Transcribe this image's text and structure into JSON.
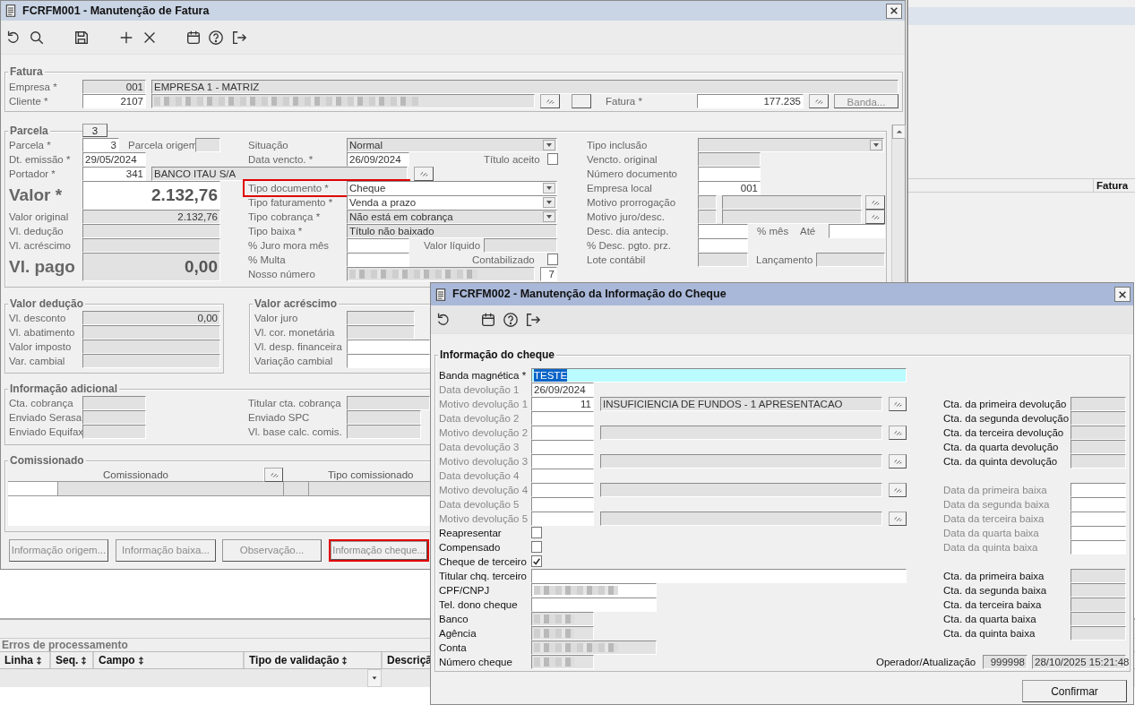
{
  "main_window": {
    "title": "FCRFM001 - Manutenção de Fatura",
    "fatura": {
      "legend": "Fatura",
      "rows": [
        [
          {
            "kind": "label",
            "text": "Empresa *"
          },
          {
            "kind": "number",
            "value": "001",
            "readonly": true
          },
          {
            "kind": "text",
            "value": "EMPRESA 1 - MATRIZ",
            "readonly": true
          }
        ],
        [
          {
            "kind": "label",
            "text": "Cliente *"
          },
          {
            "kind": "number",
            "value": "2107",
            "readonly": false
          },
          {
            "kind": "redacted",
            "readonly": true
          },
          {
            "kind": "lookup"
          },
          {
            "kind": "plain_button"
          },
          {
            "kind": "label",
            "text": "Fatura *"
          },
          {
            "kind": "number",
            "value": "177.235",
            "readonly": false
          },
          {
            "kind": "lookup"
          },
          {
            "kind": "button",
            "text": "Banda...",
            "disabled": true
          }
        ]
      ]
    },
    "parcela": {
      "legend": "Parcela",
      "tab": "3",
      "columns": [
        [
          [
            {
              "kind": "label",
              "text": "Parcela *"
            },
            {
              "kind": "number",
              "value": "3",
              "readonly": false
            },
            {
              "kind": "label",
              "text": "Parcela origem"
            },
            {
              "kind": "text",
              "readonly": true
            }
          ],
          [
            {
              "kind": "label",
              "text": "Dt. emissão *"
            },
            {
              "kind": "text",
              "value": "29/05/2024",
              "readonly": false
            }
          ],
          [
            {
              "kind": "label",
              "text": "Portador *"
            },
            {
              "kind": "number",
              "value": "341",
              "readonly": false
            },
            {
              "kind": "text",
              "value": "BANCO ITAU S/A",
              "readonly": true
            },
            {
              "kind": "lookup"
            }
          ],
          [
            {
              "kind": "big_label",
              "text": "Valor *"
            },
            {
              "kind": "big",
              "value": "2.132,76",
              "readonly": false
            }
          ],
          [
            {
              "kind": "label",
              "text": "Valor original"
            },
            {
              "kind": "number",
              "value": "2.132,76",
              "readonly": true
            }
          ],
          [
            {
              "kind": "label",
              "text": "Vl. dedução"
            },
            {
              "kind": "number",
              "readonly": true
            }
          ],
          [
            {
              "kind": "label",
              "text": "Vl. acréscimo"
            },
            {
              "kind": "number",
              "readonly": true
            }
          ],
          [
            {
              "kind": "big_label",
              "text": "Vl. pago"
            },
            {
              "kind": "big",
              "value": "0,00",
              "readonly": true
            }
          ]
        ],
        [
          [
            {
              "kind": "label",
              "text": "Situação"
            },
            {
              "kind": "select",
              "value": "Normal",
              "readonly": true
            }
          ],
          [
            {
              "kind": "label",
              "text": "Data vencto. *"
            },
            {
              "kind": "text",
              "value": "26/09/2024",
              "readonly": false
            },
            {
              "kind": "label",
              "text": "Título aceito"
            },
            {
              "kind": "check",
              "checked": false
            }
          ],
          [
            {
              "kind": "label",
              "text": "Tipo documento *",
              "highlighted": true
            },
            {
              "kind": "select",
              "value": "Cheque",
              "readonly": false
            }
          ],
          [
            {
              "kind": "label",
              "text": "Tipo faturamento *"
            },
            {
              "kind": "select",
              "value": "Venda a prazo",
              "readonly": false
            }
          ],
          [
            {
              "kind": "label",
              "text": "Tipo cobrança *"
            },
            {
              "kind": "select",
              "value": "Não está em cobrança",
              "readonly": true
            }
          ],
          [
            {
              "kind": "label",
              "text": "Tipo baixa *"
            },
            {
              "kind": "text",
              "value": "Título não baixado",
              "readonly": true
            }
          ],
          [
            {
              "kind": "label",
              "text": "% Juro mora mês"
            },
            {
              "kind": "text",
              "readonly": false
            },
            {
              "kind": "label",
              "text": "Valor líquido"
            },
            {
              "kind": "text",
              "readonly": true
            }
          ],
          [
            {
              "kind": "label",
              "text": "% Multa"
            },
            {
              "kind": "text",
              "readonly": false
            },
            {
              "kind": "label",
              "text": "Contabilizado"
            },
            {
              "kind": "check",
              "checked": false
            }
          ],
          [
            {
              "kind": "label",
              "text": "Nosso número"
            },
            {
              "kind": "redacted",
              "readonly": true
            },
            {
              "kind": "number",
              "value": "7",
              "readonly": false
            }
          ]
        ],
        [
          [
            {
              "kind": "label",
              "text": "Tipo inclusão"
            },
            {
              "kind": "select",
              "readonly": true
            }
          ],
          [
            {
              "kind": "label",
              "text": "Vencto. original"
            },
            {
              "kind": "text",
              "readonly": true
            }
          ],
          [
            {
              "kind": "label",
              "text": "Número documento"
            },
            {
              "kind": "text",
              "readonly": false
            }
          ],
          [
            {
              "kind": "label",
              "text": "Empresa local"
            },
            {
              "kind": "number",
              "value": "001",
              "readonly": false
            }
          ],
          [
            {
              "kind": "label",
              "text": "Motivo prorrogação"
            },
            {
              "kind": "text",
              "readonly": true
            },
            {
              "kind": "text",
              "readonly": true
            },
            {
              "kind": "lookup"
            }
          ],
          [
            {
              "kind": "label",
              "text": "Motivo juro/desc."
            },
            {
              "kind": "text",
              "readonly": true
            },
            {
              "kind": "text",
              "readonly": true
            },
            {
              "kind": "lookup"
            }
          ],
          [
            {
              "kind": "label",
              "text": "Desc. dia antecip."
            },
            {
              "kind": "text",
              "readonly": false
            },
            {
              "kind": "label",
              "text": "% mês"
            },
            {
              "kind": "label",
              "text": "Até"
            },
            {
              "kind": "text",
              "readonly": false
            }
          ],
          [
            {
              "kind": "label",
              "text": "% Desc. pgto. prz."
            },
            {
              "kind": "text",
              "readonly": false
            }
          ],
          [
            {
              "kind": "label",
              "text": "Lote contábil"
            },
            {
              "kind": "text",
              "readonly": true
            },
            {
              "kind": "label",
              "text": "Lançamento"
            },
            {
              "kind": "text",
              "readonly": true
            }
          ]
        ]
      ]
    },
    "valor_deducao": {
      "legend": "Valor dedução",
      "rows": [
        [
          {
            "kind": "label",
            "text": "Vl. desconto"
          },
          {
            "kind": "number",
            "value": "0,00",
            "readonly": true
          }
        ],
        [
          {
            "kind": "label",
            "text": "Vl. abatimento"
          },
          {
            "kind": "number",
            "readonly": true
          }
        ],
        [
          {
            "kind": "label",
            "text": "Valor imposto"
          },
          {
            "kind": "number",
            "readonly": true
          }
        ],
        [
          {
            "kind": "label",
            "text": "Var. cambial"
          },
          {
            "kind": "number",
            "readonly": true
          }
        ]
      ]
    },
    "valor_acrescimo": {
      "legend": "Valor acréscimo",
      "rows": [
        [
          {
            "kind": "label",
            "text": "Valor juro"
          },
          {
            "kind": "number",
            "readonly": true
          }
        ],
        [
          {
            "kind": "label",
            "text": "Vl. cor. monetária"
          },
          {
            "kind": "number",
            "readonly": true
          }
        ],
        [
          {
            "kind": "label",
            "text": "Vl. desp. financeira"
          },
          {
            "kind": "number",
            "readonly": false
          }
        ],
        [
          {
            "kind": "label",
            "text": "Variação cambial"
          },
          {
            "kind": "number",
            "readonly": false
          }
        ]
      ]
    },
    "informacao_adicional": {
      "legend": "Informação adicional",
      "rows": [
        [
          {
            "kind": "label",
            "text": "Cta. cobrança"
          },
          {
            "kind": "text",
            "readonly": true
          },
          {
            "kind": "label",
            "text": "Titular cta. cobrança"
          },
          {
            "kind": "text",
            "readonly": true
          }
        ],
        [
          {
            "kind": "label",
            "text": "Enviado Serasa"
          },
          {
            "kind": "text",
            "readonly": true
          },
          {
            "kind": "label",
            "text": "Enviado SPC"
          },
          {
            "kind": "text",
            "readonly": true
          }
        ],
        [
          {
            "kind": "label",
            "text": "Enviado Equifax"
          },
          {
            "kind": "text",
            "readonly": true
          },
          {
            "kind": "label",
            "text": "Vl. base calc. comis."
          },
          {
            "kind": "text",
            "readonly": true
          }
        ]
      ]
    },
    "comissionado": {
      "legend": "Comissionado",
      "columns": [
        "Comissionado",
        "Tipo comissionado"
      ]
    },
    "buttons": [
      {
        "label": "Informação origem...",
        "highlighted": false
      },
      {
        "label": "Informação baixa...",
        "highlighted": false
      },
      {
        "label": "Observação...",
        "highlighted": false
      },
      {
        "label": "Informação cheque...",
        "highlighted": true
      }
    ]
  },
  "background_window": {
    "header_cell": "Fatura"
  },
  "errors_panel": {
    "title": "Erros de processamento",
    "columns": [
      {
        "label": "Linha",
        "sortable": true
      },
      {
        "label": "Seq.",
        "sortable": true
      },
      {
        "label": "Campo",
        "sortable": true
      },
      {
        "label": "Tipo de validação",
        "sortable": true
      },
      {
        "label": "Descriçã"
      }
    ]
  },
  "cheque_dialog": {
    "title": "FCRFM002 - Manutenção da Informação do Cheque",
    "legend": "Informação do cheque",
    "rows": [
      [
        {
          "kind": "label",
          "text": "Banda magnética *",
          "disabled": false
        },
        {
          "kind": "text",
          "value": "TESTE",
          "readonly": false,
          "focused": true
        }
      ],
      [
        {
          "kind": "label",
          "text": "Data devolução 1",
          "disabled": true
        },
        {
          "kind": "text",
          "value": "26/09/2024",
          "readonly": false
        }
      ],
      [
        {
          "kind": "label",
          "text": "Motivo devolução 1",
          "disabled": true
        },
        {
          "kind": "number",
          "value": "11",
          "readonly": false
        },
        {
          "kind": "text",
          "value": "INSUFICIENCIA DE FUNDOS - 1 APRESENTACAO",
          "readonly": true
        },
        {
          "kind": "lookup"
        },
        {
          "kind": "label",
          "text": "Cta. da primeira devolução",
          "disabled": false
        },
        {
          "kind": "text",
          "readonly": true
        }
      ],
      [
        {
          "kind": "label",
          "text": "Data devolução 2",
          "disabled": true
        },
        {
          "kind": "text",
          "readonly": false
        },
        {
          "kind": "label",
          "text": "Cta. da segunda devolução",
          "disabled": false
        },
        {
          "kind": "text",
          "readonly": true
        }
      ],
      [
        {
          "kind": "label",
          "text": "Motivo devolução 2",
          "disabled": true
        },
        {
          "kind": "text",
          "readonly": false
        },
        {
          "kind": "text",
          "readonly": true
        },
        {
          "kind": "lookup"
        },
        {
          "kind": "label",
          "text": "Cta. da terceira devolução",
          "disabled": false
        },
        {
          "kind": "text",
          "readonly": true
        }
      ],
      [
        {
          "kind": "label",
          "text": "Data devolução 3",
          "disabled": true
        },
        {
          "kind": "text",
          "readonly": false
        },
        {
          "kind": "label",
          "text": "Cta. da quarta devolução",
          "disabled": false
        },
        {
          "kind": "text",
          "readonly": true
        }
      ],
      [
        {
          "kind": "label",
          "text": "Motivo devolução 3",
          "disabled": true
        },
        {
          "kind": "text",
          "readonly": false
        },
        {
          "kind": "text",
          "readonly": true
        },
        {
          "kind": "lookup"
        },
        {
          "kind": "label",
          "text": "Cta. da quinta devolução",
          "disabled": false
        },
        {
          "kind": "text",
          "readonly": true
        }
      ],
      [
        {
          "kind": "label",
          "text": "Data devolução 4",
          "disabled": true
        },
        {
          "kind": "text",
          "readonly": false
        }
      ],
      [
        {
          "kind": "label",
          "text": "Motivo devolução 4",
          "disabled": true
        },
        {
          "kind": "text",
          "readonly": false
        },
        {
          "kind": "text",
          "readonly": true
        },
        {
          "kind": "lookup"
        },
        {
          "kind": "label",
          "text": "Data da primeira baixa",
          "disabled": true
        },
        {
          "kind": "text",
          "readonly": false
        }
      ],
      [
        {
          "kind": "label",
          "text": "Data devolução 5",
          "disabled": true
        },
        {
          "kind": "text",
          "readonly": false
        },
        {
          "kind": "label",
          "text": "Data da segunda baixa",
          "disabled": true
        },
        {
          "kind": "text",
          "readonly": false
        }
      ],
      [
        {
          "kind": "label",
          "text": "Motivo devolução 5",
          "disabled": true
        },
        {
          "kind": "text",
          "readonly": false
        },
        {
          "kind": "text",
          "readonly": true
        },
        {
          "kind": "lookup"
        },
        {
          "kind": "label",
          "text": "Data da terceira baixa",
          "disabled": true
        },
        {
          "kind": "text",
          "readonly": false
        }
      ],
      [
        {
          "kind": "label",
          "text": "Reapresentar",
          "disabled": false
        },
        {
          "kind": "check",
          "checked": false
        },
        {
          "kind": "label",
          "text": "Data da quarta baixa",
          "disabled": true
        },
        {
          "kind": "text",
          "readonly": false
        }
      ],
      [
        {
          "kind": "label",
          "text": "Compensado",
          "disabled": false
        },
        {
          "kind": "check",
          "checked": false
        },
        {
          "kind": "label",
          "text": "Data da quinta baixa",
          "disabled": true
        },
        {
          "kind": "text",
          "readonly": false
        }
      ],
      [
        {
          "kind": "label",
          "text": "Cheque de terceiro",
          "disabled": false
        },
        {
          "kind": "check",
          "checked": true
        }
      ],
      [
        {
          "kind": "label",
          "text": "Titular chq. terceiro",
          "disabled": false
        },
        {
          "kind": "text",
          "readonly": false
        },
        {
          "kind": "label",
          "text": "Cta. da primeira baixa",
          "disabled": false
        },
        {
          "kind": "text",
          "readonly": true
        }
      ],
      [
        {
          "kind": "label",
          "text": "CPF/CNPJ",
          "disabled": false
        },
        {
          "kind": "redacted",
          "readonly": false
        },
        {
          "kind": "label",
          "text": "Cta. da segunda baixa",
          "disabled": false
        },
        {
          "kind": "text",
          "readonly": true
        }
      ],
      [
        {
          "kind": "label",
          "text": "Tel. dono cheque",
          "disabled": false
        },
        {
          "kind": "text",
          "readonly": false
        },
        {
          "kind": "label",
          "text": "Cta. da terceira baixa",
          "disabled": false
        },
        {
          "kind": "text",
          "readonly": true
        }
      ],
      [
        {
          "kind": "label",
          "text": "Banco",
          "disabled": false
        },
        {
          "kind": "redacted",
          "readonly": true
        },
        {
          "kind": "label",
          "text": "Cta. da quarta baixa",
          "disabled": false
        },
        {
          "kind": "text",
          "readonly": true
        }
      ],
      [
        {
          "kind": "label",
          "text": "Agência",
          "disabled": false
        },
        {
          "kind": "redacted",
          "readonly": true
        },
        {
          "kind": "label",
          "text": "Cta. da quinta baixa",
          "disabled": false
        },
        {
          "kind": "text",
          "readonly": true
        }
      ],
      [
        {
          "kind": "label",
          "text": "Conta",
          "disabled": false
        },
        {
          "kind": "redacted",
          "readonly": true
        }
      ],
      [
        {
          "kind": "label",
          "text": "Número cheque",
          "disabled": false
        },
        {
          "kind": "redacted",
          "readonly": true
        },
        {
          "kind": "label",
          "text": "Operador/Atualização",
          "disabled": false
        },
        {
          "kind": "number",
          "value": "999998",
          "readonly": true
        },
        {
          "kind": "text",
          "value": "28/10/2025 15:21:48",
          "readonly": true
        }
      ]
    ],
    "confirm_button": "Confirmar"
  }
}
